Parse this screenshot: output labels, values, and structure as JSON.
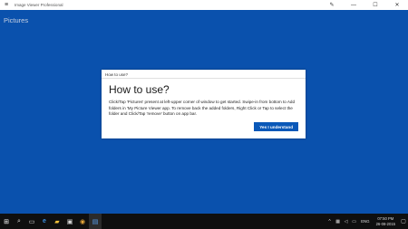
{
  "window": {
    "title": "Image Viewer Professional",
    "menu_icon": "hamburger-icon",
    "edit_icon": "pen-icon",
    "minimize_glyph": "—",
    "maximize_glyph": "☐",
    "close_glyph": "✕"
  },
  "app": {
    "pictures_label": "Pictures"
  },
  "dialog": {
    "caption": "How to use?",
    "heading": "How to use?",
    "body": "Click/Tap 'Pictures' present at left-upper corner of window to get started. Swipe-in from bottom to Add folders in 'My Picture Viewer app. To remove back the added folders, Right Click or Tap to select the folder and Click/Tap 'remove' button on app bar.",
    "button_label": "Yes I understand",
    "accent_color": "#0a58b8"
  },
  "taskbar": {
    "items": [
      {
        "name": "start-icon",
        "glyph": "⊞"
      },
      {
        "name": "search-icon",
        "glyph": "⌕"
      },
      {
        "name": "task-view-icon",
        "glyph": "▭"
      },
      {
        "name": "edge-icon",
        "glyph": "e"
      },
      {
        "name": "file-explorer-icon",
        "glyph": "▰"
      },
      {
        "name": "store-icon",
        "glyph": "▣"
      },
      {
        "name": "chrome-icon",
        "glyph": "◉"
      },
      {
        "name": "image-viewer-app-icon",
        "glyph": "▤"
      }
    ],
    "language": "ENG",
    "time": "07:50 PM",
    "date": "26-08-2015"
  },
  "colors": {
    "background": "#0a58b8",
    "taskbar": "#0f0f0f"
  }
}
